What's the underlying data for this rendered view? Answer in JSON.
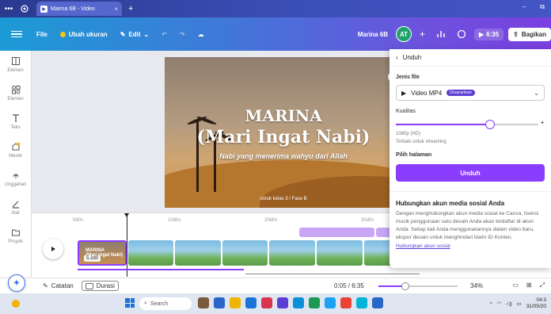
{
  "browser": {
    "tab_title": "Marina 6B - Video",
    "new_tab": "+",
    "window_controls": [
      "–",
      "–"
    ]
  },
  "toolbar": {
    "file": "File",
    "resize": "Ubah ukuran",
    "edit": "Edit",
    "project_name": "Marina 6B",
    "avatar_initials": "AT",
    "play_time": "6:35",
    "share": "Bagikan"
  },
  "sidebar": {
    "items": [
      {
        "label": "Elemen",
        "icon": "layout-icon"
      },
      {
        "label": "Elemen",
        "icon": "elements-icon"
      },
      {
        "label": "Teks",
        "icon": "text-icon"
      },
      {
        "label": "Merek",
        "icon": "brand-icon"
      },
      {
        "label": "Unggahan",
        "icon": "upload-icon"
      },
      {
        "label": "Alat",
        "icon": "draw-icon"
      },
      {
        "label": "Proyek",
        "icon": "folder-icon"
      }
    ]
  },
  "slide": {
    "title": "MARINA",
    "subtitle": "(Mari Ingat Nabi)",
    "tagline": "Nabi yang menerima wahyu dari Allah",
    "footer": "untuk kelas 3 / Fase B"
  },
  "timeline": {
    "ruler": [
      "0d0s",
      "10d0s",
      "20d0s",
      "30d0s"
    ],
    "first_clip_title": "MARINA",
    "first_clip_sub": "(Mari Ingat Nabi)",
    "first_clip_duration": "5.2d0"
  },
  "statusbar": {
    "notes": "Catatan",
    "duration": "Durasi",
    "time": "0:05 / 6:35",
    "zoom_pct": "34%",
    "zoom_value": 0.34
  },
  "panel": {
    "back_title": "Unduh",
    "file_type_label": "Jenis file",
    "file_type_value": "Video MP4",
    "recommended_badge": "Disarankan",
    "quality_label": "Kualitas",
    "quality_value": "1080p (HD)",
    "quality_note": "Terbaik untuk streaming",
    "quality_fraction": 0.66,
    "pages_label": "Pilih halaman",
    "download_button": "Unduh",
    "social_title": "Hubungkan akun media sosial Anda",
    "social_body": "Dengan menghubungkan akun media sosial ke Canva, lisensi musik penggunaan satu desain Anda akan terdaftar di akun Anda. Setiap kali Anda menggunakannya dalam video baru, ekspor desain untuk menghindari klaim ID Konten.",
    "social_link": "Hubungkan akun sosial"
  },
  "taskbar": {
    "search": "Search",
    "time": "04:3",
    "date": "31/05/20"
  },
  "colors": {
    "accent": "#8b3dff",
    "avatar": "#1ea36a",
    "badge": "#5b3fd4"
  }
}
